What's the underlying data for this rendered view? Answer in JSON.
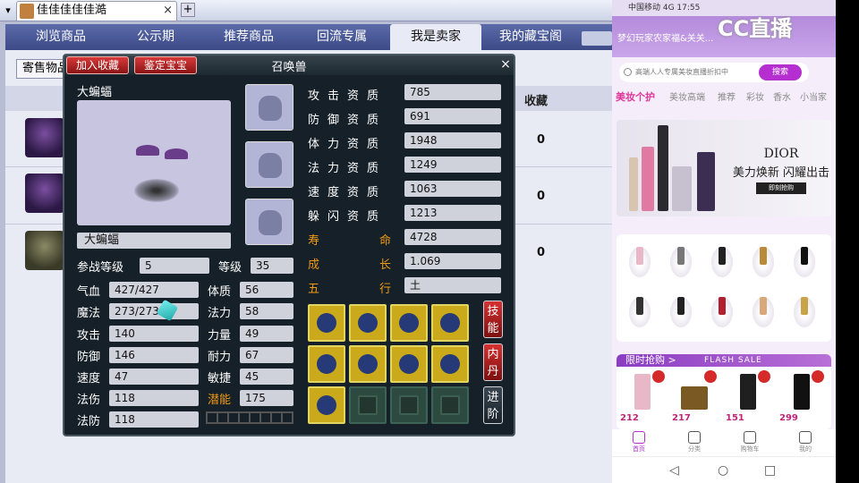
{
  "window": {
    "tab_title": "佳佳佳佳佳澔",
    "close": "×",
    "new_tab": "+"
  },
  "nav": {
    "items": [
      "浏览商品",
      "公示期",
      "推荐商品",
      "回流专属",
      "我是卖家",
      "我的藏宝阁"
    ],
    "active_index": 4
  },
  "content": {
    "sell_button": "寄售物品",
    "fav_header": "收藏",
    "rows": [
      {
        "fav": "0"
      },
      {
        "fav": "0"
      },
      {
        "fav": "0"
      }
    ]
  },
  "dialog": {
    "title": "召唤兽",
    "btn_collect": "加入收藏",
    "btn_appraise": "鉴定宝宝",
    "close": "×",
    "pet_name": "大蝙蝠",
    "name_field": "大蝙蝠",
    "battle_level_label": "参战等级",
    "battle_level": "5",
    "level_label": "等级",
    "level": "35",
    "aptitudes": [
      {
        "label": "攻击资质",
        "value": "785"
      },
      {
        "label": "防御资质",
        "value": "691"
      },
      {
        "label": "体力资质",
        "value": "1948"
      },
      {
        "label": "法力资质",
        "value": "1249"
      },
      {
        "label": "速度资质",
        "value": "1063"
      },
      {
        "label": "躲闪资质",
        "value": "1213"
      }
    ],
    "lifespan_label_a": "寿",
    "lifespan_label_b": "命",
    "lifespan": "4728",
    "growth_label_a": "成",
    "growth_label_b": "长",
    "growth": "1.069",
    "element_label_a": "五",
    "element_label_b": "行",
    "element": "土",
    "stats_left": [
      {
        "label": "气血",
        "value": "427/427"
      },
      {
        "label": "魔法",
        "value": "273/273"
      },
      {
        "label": "攻击",
        "value": "140"
      },
      {
        "label": "防御",
        "value": "146"
      },
      {
        "label": "速度",
        "value": "47"
      },
      {
        "label": "法伤",
        "value": "118"
      },
      {
        "label": "法防",
        "value": "118"
      }
    ],
    "stats_right": [
      {
        "label": "体质",
        "value": "56"
      },
      {
        "label": "法力",
        "value": "58"
      },
      {
        "label": "力量",
        "value": "49"
      },
      {
        "label": "耐力",
        "value": "67"
      },
      {
        "label": "敏捷",
        "value": "45"
      },
      {
        "label": "潜能",
        "value": "175"
      }
    ],
    "side_buttons": [
      [
        "技",
        "能"
      ],
      [
        "内",
        "丹"
      ],
      [
        "进",
        "阶"
      ]
    ]
  },
  "phone": {
    "status": "中国移动 4G 17:55",
    "watermark": "CC直播",
    "notice": "梦幻玩家农家福&关关...",
    "search_placeholder": "高端人人专属美妆直播折扣中",
    "search_button": "搜索",
    "categories": [
      "美妆个护",
      "美妆高端",
      "推荐",
      "彩妆",
      "香水",
      "小当家"
    ],
    "banner_brand": "DIOR",
    "banner_slogan": "美力焕新 闪耀出击",
    "banner_button": "即刻抢购",
    "flash_title": "限时抢购 >",
    "flash_sale": "FLASH SALE",
    "flash_prices": [
      "212",
      "217",
      "151",
      "299"
    ],
    "tabbar": [
      "首页",
      "分类",
      "购物车",
      "我的"
    ]
  },
  "colors": {
    "accent_red": "#d83a3a",
    "gold": "#f09a14",
    "nav_blue": "#4a5896",
    "phone_accent": "#b52fd0"
  }
}
